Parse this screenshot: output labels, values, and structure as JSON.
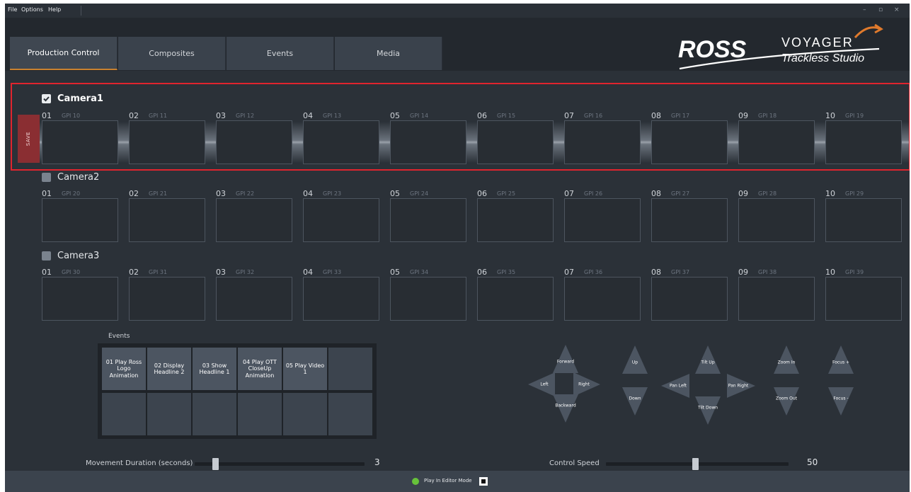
{
  "menu": [
    "File",
    "Options",
    "Help"
  ],
  "window_controls": {
    "minimize": "–",
    "maximize": "▫",
    "close": "×"
  },
  "tabs": [
    {
      "label": "Production Control",
      "active": true
    },
    {
      "label": "Composites",
      "active": false
    },
    {
      "label": "Events",
      "active": false
    },
    {
      "label": "Media",
      "active": false
    }
  ],
  "logo": {
    "brand": "ROSS",
    "product_line1": "VOYAGER",
    "product_line2": "Trackless Studio"
  },
  "save_label": "SAVE",
  "cameras": [
    {
      "name": "Camera1",
      "checked": true,
      "slots": [
        {
          "num": "01",
          "gpi": "GPI 10"
        },
        {
          "num": "02",
          "gpi": "GPI 11"
        },
        {
          "num": "03",
          "gpi": "GPI 12"
        },
        {
          "num": "04",
          "gpi": "GPI 13"
        },
        {
          "num": "05",
          "gpi": "GPI 14"
        },
        {
          "num": "06",
          "gpi": "GPI 15"
        },
        {
          "num": "07",
          "gpi": "GPI 16"
        },
        {
          "num": "08",
          "gpi": "GPI 17"
        },
        {
          "num": "09",
          "gpi": "GPI 18"
        },
        {
          "num": "10",
          "gpi": "GPI 19"
        }
      ]
    },
    {
      "name": "Camera2",
      "checked": false,
      "slots": [
        {
          "num": "01",
          "gpi": "GPI 20"
        },
        {
          "num": "02",
          "gpi": "GPI 21"
        },
        {
          "num": "03",
          "gpi": "GPI 22"
        },
        {
          "num": "04",
          "gpi": "GPI 23"
        },
        {
          "num": "05",
          "gpi": "GPI 24"
        },
        {
          "num": "06",
          "gpi": "GPI 25"
        },
        {
          "num": "07",
          "gpi": "GPI 26"
        },
        {
          "num": "08",
          "gpi": "GPI 27"
        },
        {
          "num": "09",
          "gpi": "GPI 28"
        },
        {
          "num": "10",
          "gpi": "GPI 29"
        }
      ]
    },
    {
      "name": "Camera3",
      "checked": false,
      "slots": [
        {
          "num": "01",
          "gpi": "GPI 30"
        },
        {
          "num": "02",
          "gpi": "GPI 31"
        },
        {
          "num": "03",
          "gpi": "GPI 32"
        },
        {
          "num": "04",
          "gpi": "GPI 33"
        },
        {
          "num": "05",
          "gpi": "GPI 34"
        },
        {
          "num": "06",
          "gpi": "GPI 35"
        },
        {
          "num": "07",
          "gpi": "GPI 36"
        },
        {
          "num": "08",
          "gpi": "GPI 37"
        },
        {
          "num": "09",
          "gpi": "GPI 38"
        },
        {
          "num": "10",
          "gpi": "GPI 39"
        }
      ]
    }
  ],
  "events": {
    "label": "Events",
    "buttons": [
      "01 Play Ross Logo Animation",
      "02 Display Headline 2",
      "03 Show Headline 1",
      "04 Play OTT CloseUp Animation",
      "05 Play Video 1",
      "",
      "",
      "",
      "",
      "",
      "",
      ""
    ]
  },
  "controls": {
    "forward": "Forward",
    "left": "Left",
    "right": "Right",
    "backward": "Backward",
    "up": "Up",
    "down": "Down",
    "tilt_up": "Tilt Up",
    "pan_left": "Pan Left",
    "pan_right": "Pan Right",
    "tilt_down": "Tilt Down",
    "zoom_in": "Zoom In",
    "zoom_out": "Zoom Out",
    "focus_plus": "Focus +",
    "focus_minus": "Focus -"
  },
  "movement_duration": {
    "label": "Movement Duration (seconds)",
    "value": "3",
    "fraction": 0.12
  },
  "control_speed": {
    "label": "Control Speed",
    "value": "50",
    "fraction": 0.49
  },
  "status": {
    "text": "Play In Editor Mode",
    "indicator_color": "#67c23a"
  },
  "colors": {
    "accent_tab": "#c9812f",
    "save": "#8a2e32",
    "highlight": "#e0242e"
  }
}
